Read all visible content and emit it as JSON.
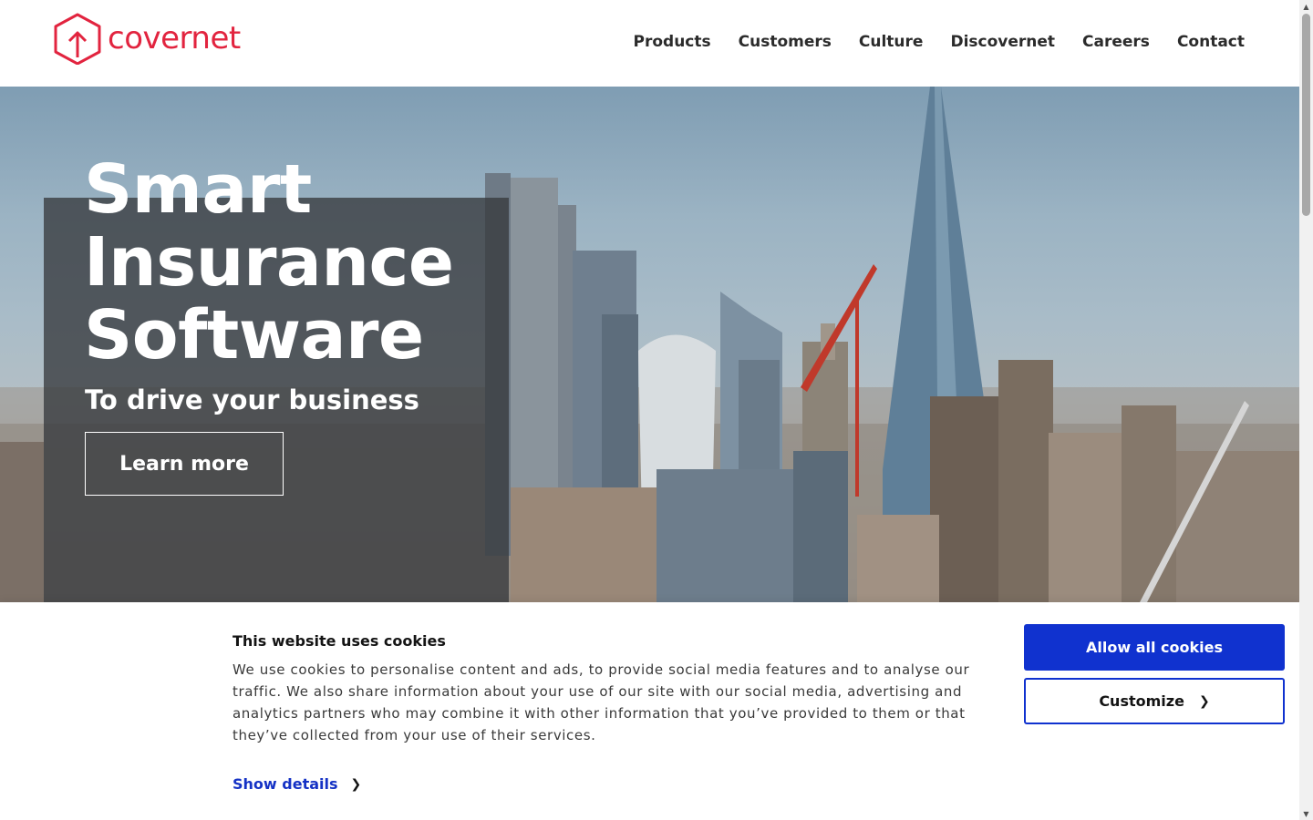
{
  "brand": {
    "name": "covernet",
    "color": "#e2243f"
  },
  "nav": {
    "items": [
      {
        "label": "Products"
      },
      {
        "label": "Customers"
      },
      {
        "label": "Culture"
      },
      {
        "label": "Discovernet"
      },
      {
        "label": "Careers"
      },
      {
        "label": "Contact"
      }
    ]
  },
  "hero": {
    "title_lines": [
      "Smart",
      "Insurance",
      "Software"
    ],
    "subtitle": "To drive your business",
    "cta_label": "Learn more"
  },
  "cookie_banner": {
    "title": "This website uses cookies",
    "body": "We use cookies to personalise content and ads, to provide social media features and to analyse our traffic. We also share information about your use of our site with our social media, advertising and analytics partners who may combine it with other information that you’ve provided to them or that they’ve collected from your use of their services.",
    "show_details_label": "Show details",
    "allow_all_label": "Allow all cookies",
    "customize_label": "Customize",
    "accent_color": "#1032cf"
  },
  "icons": {
    "logo": "house-arrow-logo-icon",
    "chevron": "chevron-right-icon"
  }
}
